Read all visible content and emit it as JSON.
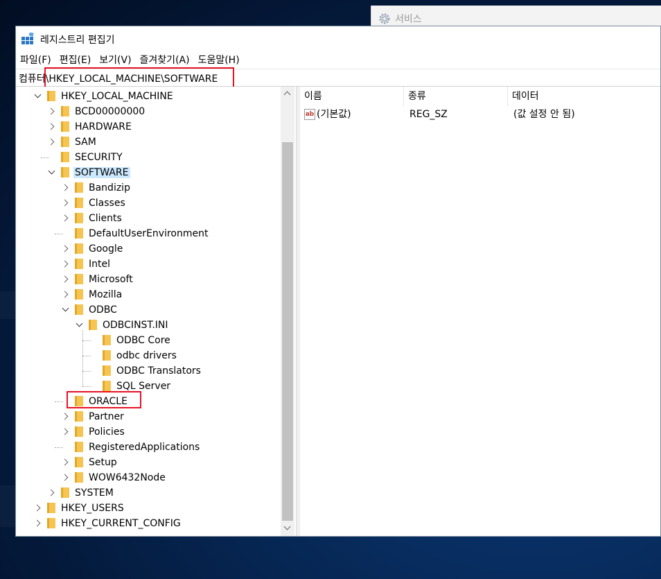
{
  "background_window": {
    "title": "서비스"
  },
  "window": {
    "title": "레지스트리 편집기"
  },
  "menu": [
    "파일(F)",
    "편집(E)",
    "보기(V)",
    "즐겨찾기(A)",
    "도움말(H)"
  ],
  "address": "컴퓨터\\HKEY_LOCAL_MACHINE\\SOFTWARE",
  "tree": [
    {
      "label": "HKEY_LOCAL_MACHINE",
      "state": "expanded",
      "level": 0
    },
    {
      "label": "BCD00000000",
      "state": "collapsed",
      "level": 1
    },
    {
      "label": "HARDWARE",
      "state": "collapsed",
      "level": 1
    },
    {
      "label": "SAM",
      "state": "collapsed",
      "level": 1
    },
    {
      "label": "SECURITY",
      "state": "leaf",
      "level": 1
    },
    {
      "label": "SOFTWARE",
      "state": "expanded",
      "level": 1,
      "selected": true
    },
    {
      "label": "Bandizip",
      "state": "collapsed",
      "level": 2
    },
    {
      "label": "Classes",
      "state": "collapsed",
      "level": 2
    },
    {
      "label": "Clients",
      "state": "collapsed",
      "level": 2
    },
    {
      "label": "DefaultUserEnvironment",
      "state": "leaf",
      "level": 2
    },
    {
      "label": "Google",
      "state": "collapsed",
      "level": 2
    },
    {
      "label": "Intel",
      "state": "collapsed",
      "level": 2
    },
    {
      "label": "Microsoft",
      "state": "collapsed",
      "level": 2
    },
    {
      "label": "Mozilla",
      "state": "collapsed",
      "level": 2
    },
    {
      "label": "ODBC",
      "state": "expanded",
      "level": 2
    },
    {
      "label": "ODBCINST.INI",
      "state": "expanded",
      "level": 3
    },
    {
      "label": "ODBC Core",
      "state": "leaf",
      "level": 4
    },
    {
      "label": "odbc drivers",
      "state": "leaf",
      "level": 4
    },
    {
      "label": "ODBC Translators",
      "state": "leaf",
      "level": 4
    },
    {
      "label": "SQL Server",
      "state": "leaf",
      "level": 4
    },
    {
      "label": "ORACLE",
      "state": "leaf",
      "level": 2
    },
    {
      "label": "Partner",
      "state": "collapsed",
      "level": 2
    },
    {
      "label": "Policies",
      "state": "collapsed",
      "level": 2
    },
    {
      "label": "RegisteredApplications",
      "state": "leaf",
      "level": 2
    },
    {
      "label": "Setup",
      "state": "collapsed",
      "level": 2
    },
    {
      "label": "WOW6432Node",
      "state": "collapsed",
      "level": 2
    },
    {
      "label": "SYSTEM",
      "state": "collapsed",
      "level": 1
    },
    {
      "label": "HKEY_USERS",
      "state": "collapsed",
      "level": 0
    },
    {
      "label": "HKEY_CURRENT_CONFIG",
      "state": "collapsed",
      "level": 0
    }
  ],
  "list": {
    "columns": [
      "이름",
      "종류",
      "데이터"
    ],
    "rows": [
      {
        "icon": "string-value-icon",
        "icon_text": "ab",
        "name": "(기본값)",
        "type": "REG_SZ",
        "data": "(값 설정 안 됨)"
      }
    ]
  },
  "colors": {
    "highlight": "#e81123",
    "selection": "#cce8ff",
    "folder": "#f5c451"
  }
}
